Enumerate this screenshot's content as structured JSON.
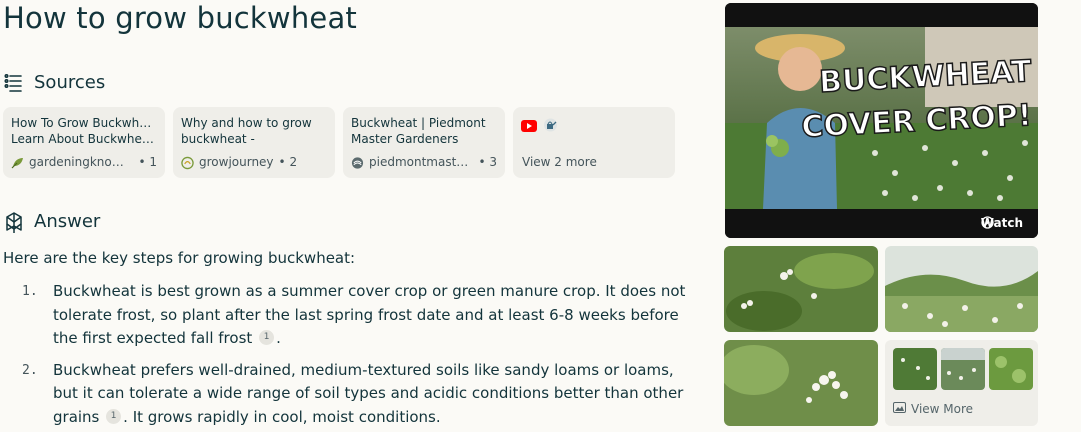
{
  "page": {
    "title": "How to grow buckwheat"
  },
  "sources": {
    "heading": "Sources",
    "cards": [
      {
        "title_line1": "How To Grow Buckwheat:",
        "title_line2": "Learn About Buckwheat...",
        "site": "gardeningknowh...",
        "index": "• 1",
        "favicon": "leaf-icon"
      },
      {
        "title_line1": "Why and how to grow",
        "title_line2": "buckwheat -",
        "site": "growjourney",
        "index": "• 2",
        "favicon": "growjourney-logo-icon"
      },
      {
        "title_line1": "Buckwheat | Piedmont",
        "title_line2": "Master Gardeners",
        "site": "piedmontmaster...",
        "index": "• 3",
        "favicon": "piedmont-logo-icon"
      }
    ],
    "more": {
      "label": "View 2 more",
      "icons": [
        "youtube-icon",
        "watering-can-icon"
      ]
    }
  },
  "answer": {
    "heading": "Answer",
    "intro": "Here are the key steps for growing buckwheat:",
    "items": [
      {
        "num": "1.",
        "text": "Buckwheat is best grown as a summer cover crop or green manure crop. It does not tolerate frost, so plant after the last spring frost date and at least 6-8 weeks before the first expected fall frost",
        "cite": "1",
        "after": "."
      },
      {
        "num": "2.",
        "text": "Buckwheat prefers well-drained, medium-textured soils like sandy loams or loams, but it can tolerate a wide range of soil types and acidic conditions better than other grains",
        "cite": "1",
        "after": ". It grows rapidly in cool, moist conditions."
      }
    ]
  },
  "media": {
    "video": {
      "overlay_line1": "BUCKWHEAT",
      "overlay_line2": "COVER CROP!",
      "watch_label": "Watch"
    },
    "view_more_label": "View More"
  },
  "colors": {
    "background": "#fbfaf6",
    "text": "#13343b",
    "card": "#efeee9",
    "youtube_red": "#ff0000"
  }
}
